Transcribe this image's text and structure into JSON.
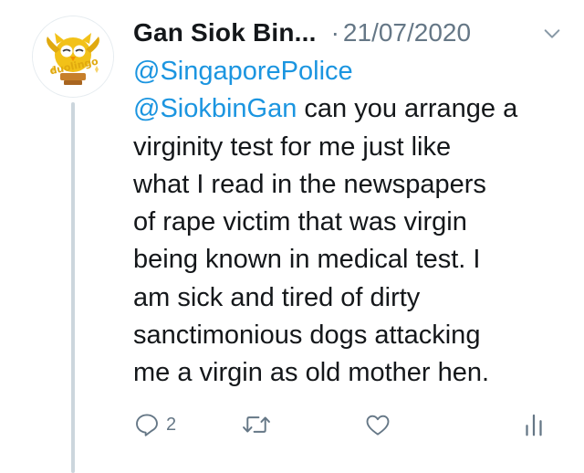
{
  "tweet": {
    "avatar": {
      "brand_text": "duolingo",
      "description_icon": "duolingo-owl-icon"
    },
    "display_name": "Gan Siok Bin...",
    "separator": "·",
    "timestamp": "21/07/2020",
    "body_lines": [
      {
        "mention": "@SingaporePolice",
        "text": ""
      },
      {
        "mention": "@SiokbinGan",
        "text": " can you arrange a"
      },
      {
        "mention": "",
        "text": "virginity test for me just like"
      },
      {
        "mention": "",
        "text": "what I read in the newspapers"
      },
      {
        "mention": "",
        "text": "of rape victim that was virgin"
      },
      {
        "mention": "",
        "text": "being known in medical test. I"
      },
      {
        "mention": "",
        "text": "am sick and tired of dirty"
      },
      {
        "mention": "",
        "text": "sanctimonious dogs attacking"
      },
      {
        "mention": "",
        "text": "me a virgin as old mother hen."
      }
    ],
    "actions": {
      "reply_count": "2",
      "retweet_count": "",
      "like_count": ""
    }
  },
  "colors": {
    "text": "#14171a",
    "secondary": "#657786",
    "mention": "#1b95e0",
    "thread_line": "#ccd6dd",
    "owl_green": "#f2c118"
  }
}
